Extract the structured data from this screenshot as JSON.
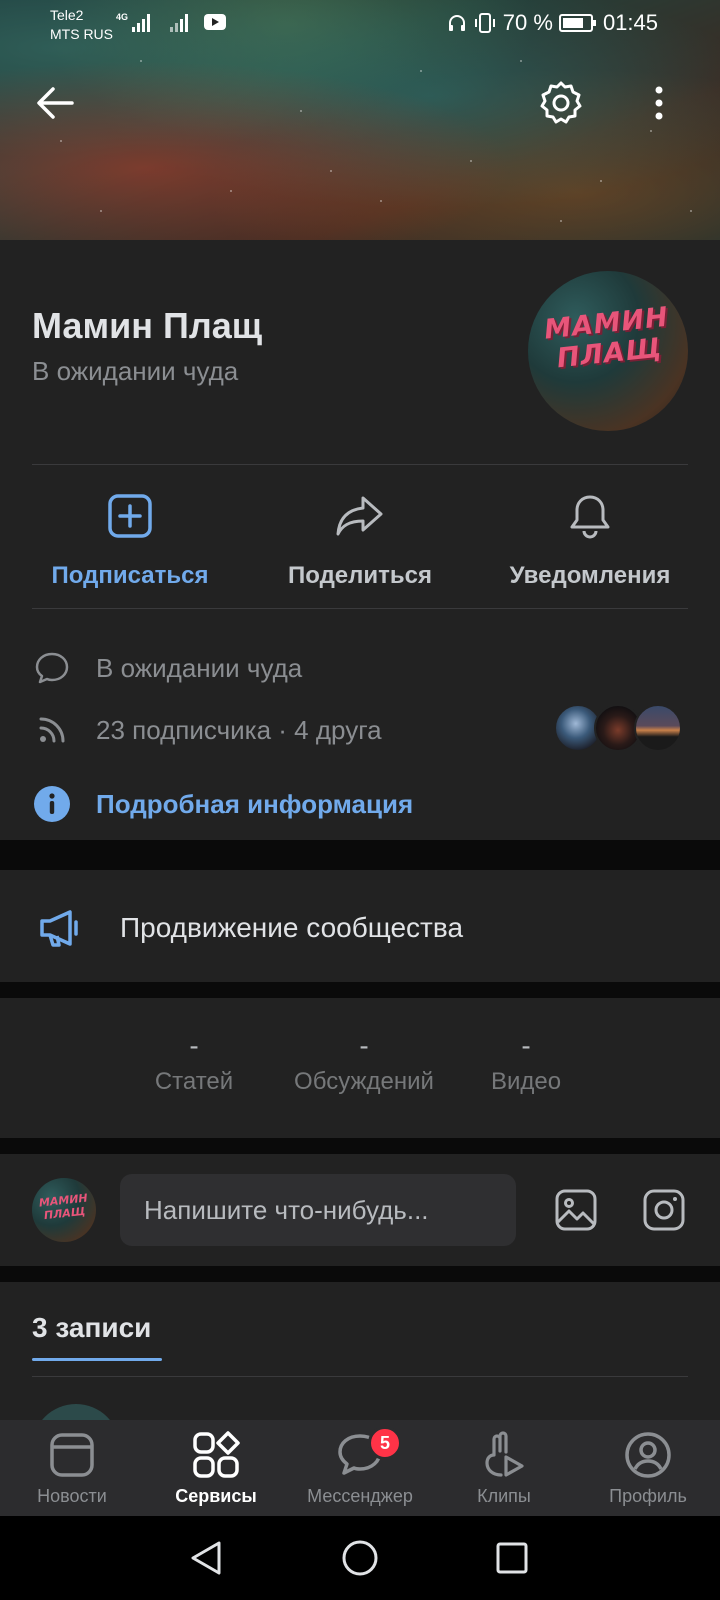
{
  "status_bar": {
    "carrier_1": "Tele2",
    "carrier_2": "MTS RUS",
    "network": "4G",
    "battery": "70 %",
    "time": "01:45"
  },
  "top_bar": {
    "back_icon": "arrow-left-icon",
    "settings_icon": "gear-icon",
    "menu_icon": "more-vertical-icon"
  },
  "profile": {
    "name": "Мамин Плащ",
    "status": "В ожидании чуда",
    "avatar_logo": "МАМИН ПЛАЩ"
  },
  "actions": [
    {
      "label": "Подписаться",
      "icon": "plus-square-icon",
      "accent": "#71aaeb"
    },
    {
      "label": "Поделиться",
      "icon": "share-arrow-icon"
    },
    {
      "label": "Уведомления",
      "icon": "bell-icon"
    }
  ],
  "info": {
    "status_text": "В ожидании чуда",
    "followers_text": "23 подписчика · 4 друга",
    "details_link": "Подробная информация"
  },
  "promo": {
    "label": "Продвижение сообщества",
    "icon": "megaphone-icon"
  },
  "counters": [
    {
      "value": "-",
      "label": "Статей"
    },
    {
      "value": "-",
      "label": "Обсуждений"
    },
    {
      "value": "-",
      "label": "Видео"
    }
  ],
  "composer": {
    "placeholder": "Напишите что-нибудь...",
    "photo_icon": "image-icon",
    "camera_icon": "camera-icon"
  },
  "posts": {
    "title": "3 записи"
  },
  "tabbar": {
    "items": [
      {
        "label": "Новости",
        "icon": "news-icon"
      },
      {
        "label": "Сервисы",
        "icon": "services-icon",
        "active": true
      },
      {
        "label": "Мессенджер",
        "icon": "chat-icon",
        "badge": "5"
      },
      {
        "label": "Клипы",
        "icon": "clips-icon"
      },
      {
        "label": "Профиль",
        "icon": "profile-icon"
      }
    ]
  },
  "colors": {
    "accent": "#71aaeb",
    "background": "#0a0a0a",
    "card": "#222222",
    "badge": "#ff3347"
  }
}
